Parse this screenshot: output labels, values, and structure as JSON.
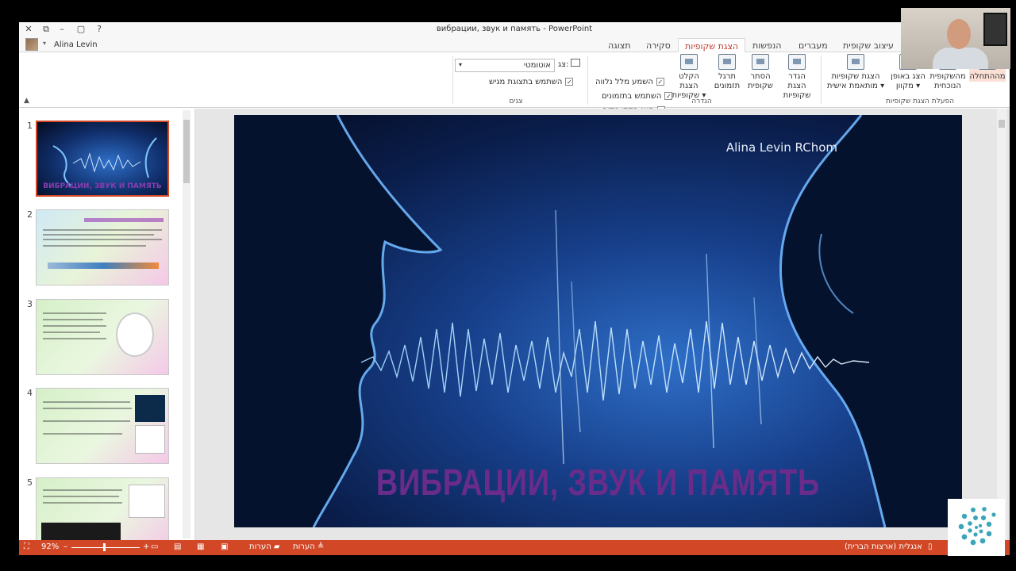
{
  "window": {
    "title": "вибрации, звук и память - PowerPoint",
    "user": "Alina Levin",
    "controls": [
      "✕",
      "⧉",
      "–",
      "▢",
      "?"
    ]
  },
  "tabs": [
    "עיצוב שקופית",
    "מעברים",
    "הנפשות",
    "הצגת שקופיות",
    "סקירה",
    "תצוגה"
  ],
  "active_tab": "הצגת שקופיות",
  "ribbon": {
    "start_group": {
      "label": "הפעלת הצגת שקופיות",
      "buttons": [
        {
          "label": "מההתחלה",
          "name": "from-beginning-button"
        },
        {
          "label": "מהשקופית הנוכחית",
          "name": "from-current-slide-button"
        },
        {
          "label": "הצג באופן מקוון ▾",
          "name": "present-online-button"
        },
        {
          "label": "הצגת שקופיות מותאמת אישית ▾",
          "name": "custom-slideshow-button"
        }
      ]
    },
    "setup_group": {
      "label": "הגדרה",
      "buttons": [
        {
          "label": "הגדר הצגת שקופיות",
          "name": "setup-slideshow-button"
        },
        {
          "label": "הסתר שקופית",
          "name": "hide-slide-button"
        },
        {
          "label": "תרגל תזמונים",
          "name": "rehearse-timings-button"
        },
        {
          "label": "הקלט הצגת שקופיות ▾",
          "name": "record-slideshow-button"
        }
      ],
      "checks": [
        "השמע מלל נלווה",
        "השתמש בתזמונים",
        "הצג פקדי מדיה"
      ]
    },
    "monitors_group": {
      "label": "צגים",
      "monitor_label": "צג:",
      "monitor_value": "אוטומטי",
      "presenter_view": "השתמש בתצוגת מגיש"
    }
  },
  "thumbnails": [
    {
      "num": "1",
      "title": "ВИБРАЦИИ, ЗВУК И ПАМЯТЬ"
    },
    {
      "num": "2"
    },
    {
      "num": "3"
    },
    {
      "num": "4"
    },
    {
      "num": "5"
    }
  ],
  "slide": {
    "author": "Alina Levin RChom",
    "title": "ВИБРАЦИИ, ЗВУК И ПАМЯТЬ"
  },
  "status": {
    "zoom": "92%",
    "notes": "הערות",
    "comments": "הערות",
    "language": "אנגלית (ארצות הברית)"
  }
}
